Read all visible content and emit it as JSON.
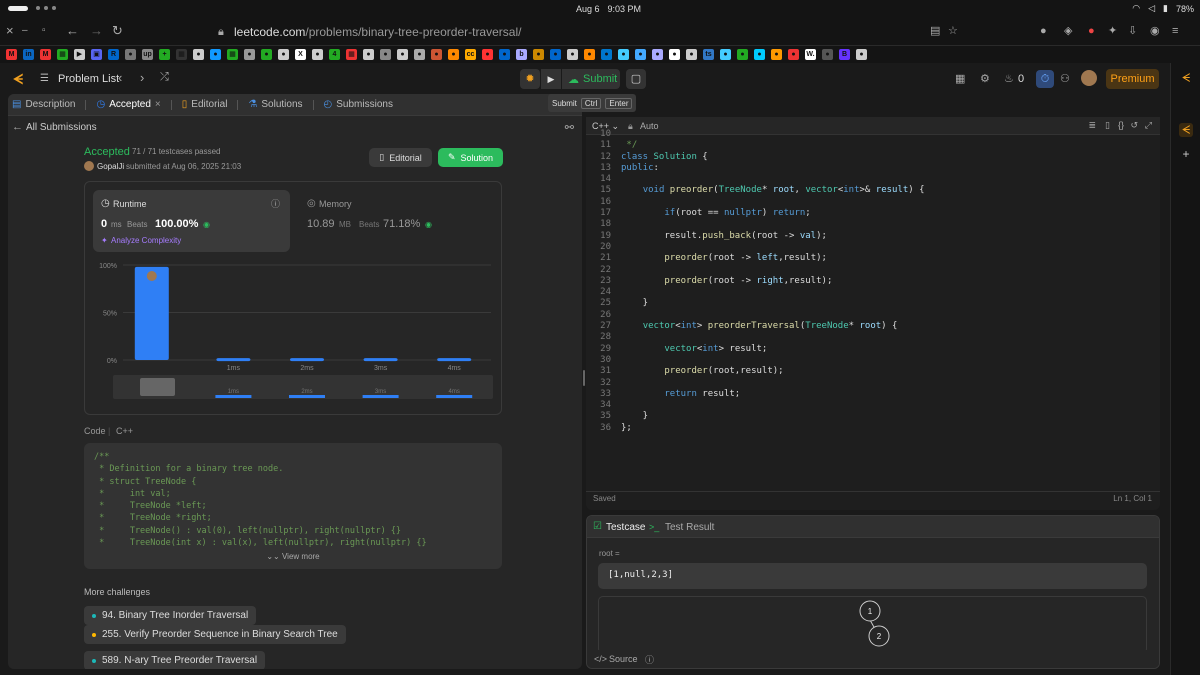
{
  "os": {
    "date": "Aug 6",
    "time": "9:03 PM",
    "battery": "78%"
  },
  "browser": {
    "url_domain": "leetcode.com",
    "url_path": "/problems/binary-tree-preorder-traversal/",
    "bookmark_badge": "17"
  },
  "bookmarks": [
    "M",
    "in",
    "M",
    "▦",
    "▶",
    "▣",
    "R",
    "●",
    "up",
    "+",
    "▦",
    "●",
    "●",
    "▦",
    "●",
    "●",
    "●",
    "X",
    "●",
    "4",
    "▦",
    "●",
    "●",
    "●",
    "●",
    "●",
    "●",
    "cc",
    "●",
    "●",
    "b",
    "●",
    "●",
    "●",
    "●",
    "●",
    "●",
    "●",
    "●",
    "●",
    "●",
    "ts",
    "●",
    "●",
    "●",
    "●",
    "●",
    "W.",
    "●",
    "B",
    "●"
  ],
  "lc_header": {
    "problem_list": "Problem List",
    "submit": "Submit",
    "premium": "Premium",
    "streak": "0",
    "tooltip": [
      "Submit",
      "Ctrl",
      "Enter"
    ]
  },
  "left_tabs": [
    {
      "label": "Description",
      "icon": "doc-icon"
    },
    {
      "label": "Accepted",
      "icon": "check-icon",
      "close": "×"
    },
    {
      "label": "Editorial",
      "icon": "book-icon"
    },
    {
      "label": "Solutions",
      "icon": "flask-icon"
    },
    {
      "label": "Submissions",
      "icon": "history-icon"
    }
  ],
  "submission": {
    "back_label": "All Submissions",
    "status": "Accepted",
    "tests": "71 / 71 testcases passed",
    "user": "GopalJi",
    "submitted": "submitted at Aug 06, 2025 21:03",
    "editorial_btn": "Editorial",
    "solution_btn": "Solution"
  },
  "runtime": {
    "title": "Runtime",
    "value": "0",
    "unit": "ms",
    "beats_label": "Beats",
    "beats": "100.00%",
    "analyze": "Analyze Complexity"
  },
  "memory": {
    "title": "Memory",
    "value": "10.89",
    "unit": "MB",
    "beats_label": "Beats",
    "beats": "71.18%"
  },
  "chart_data": {
    "type": "bar",
    "categories": [
      "",
      "1ms",
      "2ms",
      "3ms",
      "4ms"
    ],
    "values": [
      98,
      2,
      2,
      2,
      2
    ],
    "ylabels": [
      "100%",
      "50%",
      "0%"
    ],
    "ylim": [
      0,
      100
    ],
    "slider_labels": [
      "1ms",
      "2ms",
      "3ms",
      "4ms"
    ],
    "highlight": "#2f7ff5"
  },
  "code_section": {
    "label": "Code",
    "lang": "C++",
    "view_more": "View more",
    "lines": [
      "/**",
      " * Definition for a binary tree node.",
      " * struct TreeNode {",
      " *     int val;",
      " *     TreeNode *left;",
      " *     TreeNode *right;",
      " *     TreeNode() : val(0), left(nullptr), right(nullptr) {}",
      " *     TreeNode(int x) : val(x), left(nullptr), right(nullptr) {}"
    ]
  },
  "challenges": {
    "label": "More challenges",
    "items": [
      "94. Binary Tree Inorder Traversal",
      "255. Verify Preorder Sequence in Binary Search Tree",
      "589. N-ary Tree Preorder Traversal"
    ]
  },
  "editor": {
    "lang": "C++",
    "mode": "Auto",
    "status": "Saved",
    "pos": "Ln 1, Col 1",
    "start_line": 10
  },
  "testcase": {
    "tab1": "Testcase",
    "tab2": "Test Result",
    "var": "root =",
    "value": "[1,null,2,3]",
    "node1": "1",
    "node2": "2",
    "source": "Source"
  }
}
